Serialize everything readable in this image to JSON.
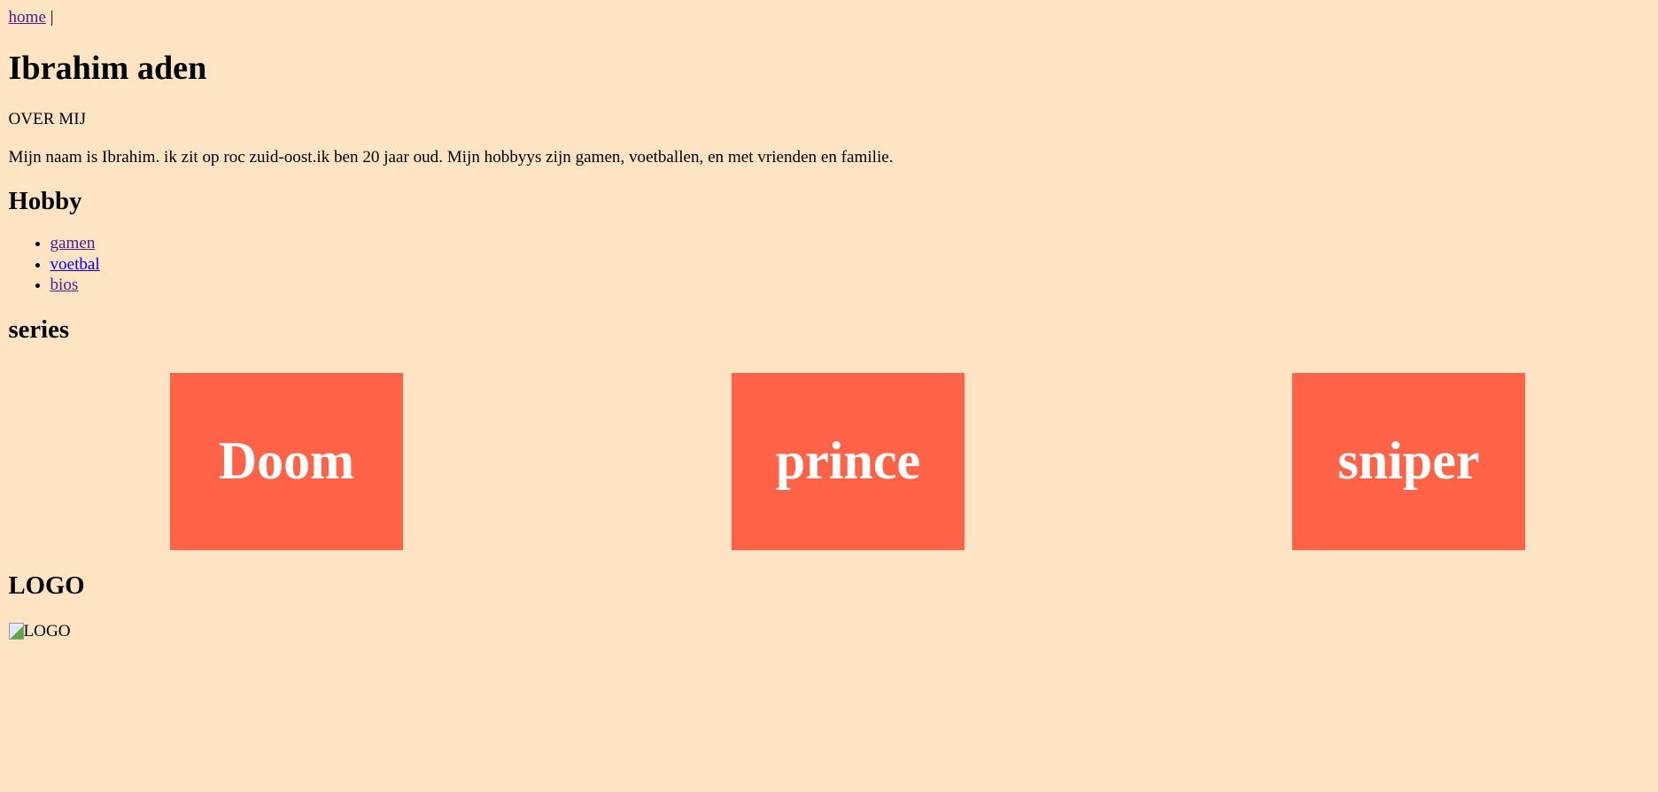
{
  "nav": {
    "home_label": "home",
    "separator": "|"
  },
  "title": "Ibrahim aden",
  "about": {
    "heading": "OVER MIJ",
    "text": "Mijn naam is Ibrahim. ik zit op roc zuid-oost.ik ben 20 jaar oud. Mijn hobbyys zijn gamen, voetballen, en met vrienden en familie."
  },
  "hobby": {
    "heading": "Hobby",
    "items": [
      {
        "label": "gamen",
        "visited": true
      },
      {
        "label": "voetbal",
        "visited": false
      },
      {
        "label": "bios",
        "visited": true
      }
    ]
  },
  "series": {
    "heading": "series",
    "cards": [
      {
        "label": "Doom"
      },
      {
        "label": "prince"
      },
      {
        "label": "sniper"
      }
    ]
  },
  "logo": {
    "heading": "LOGO",
    "alt": "LOGO"
  },
  "colors": {
    "background": "#ffe4c4",
    "card": "#ff6347",
    "link": "#0000ee",
    "visited_link": "#551a8b"
  }
}
